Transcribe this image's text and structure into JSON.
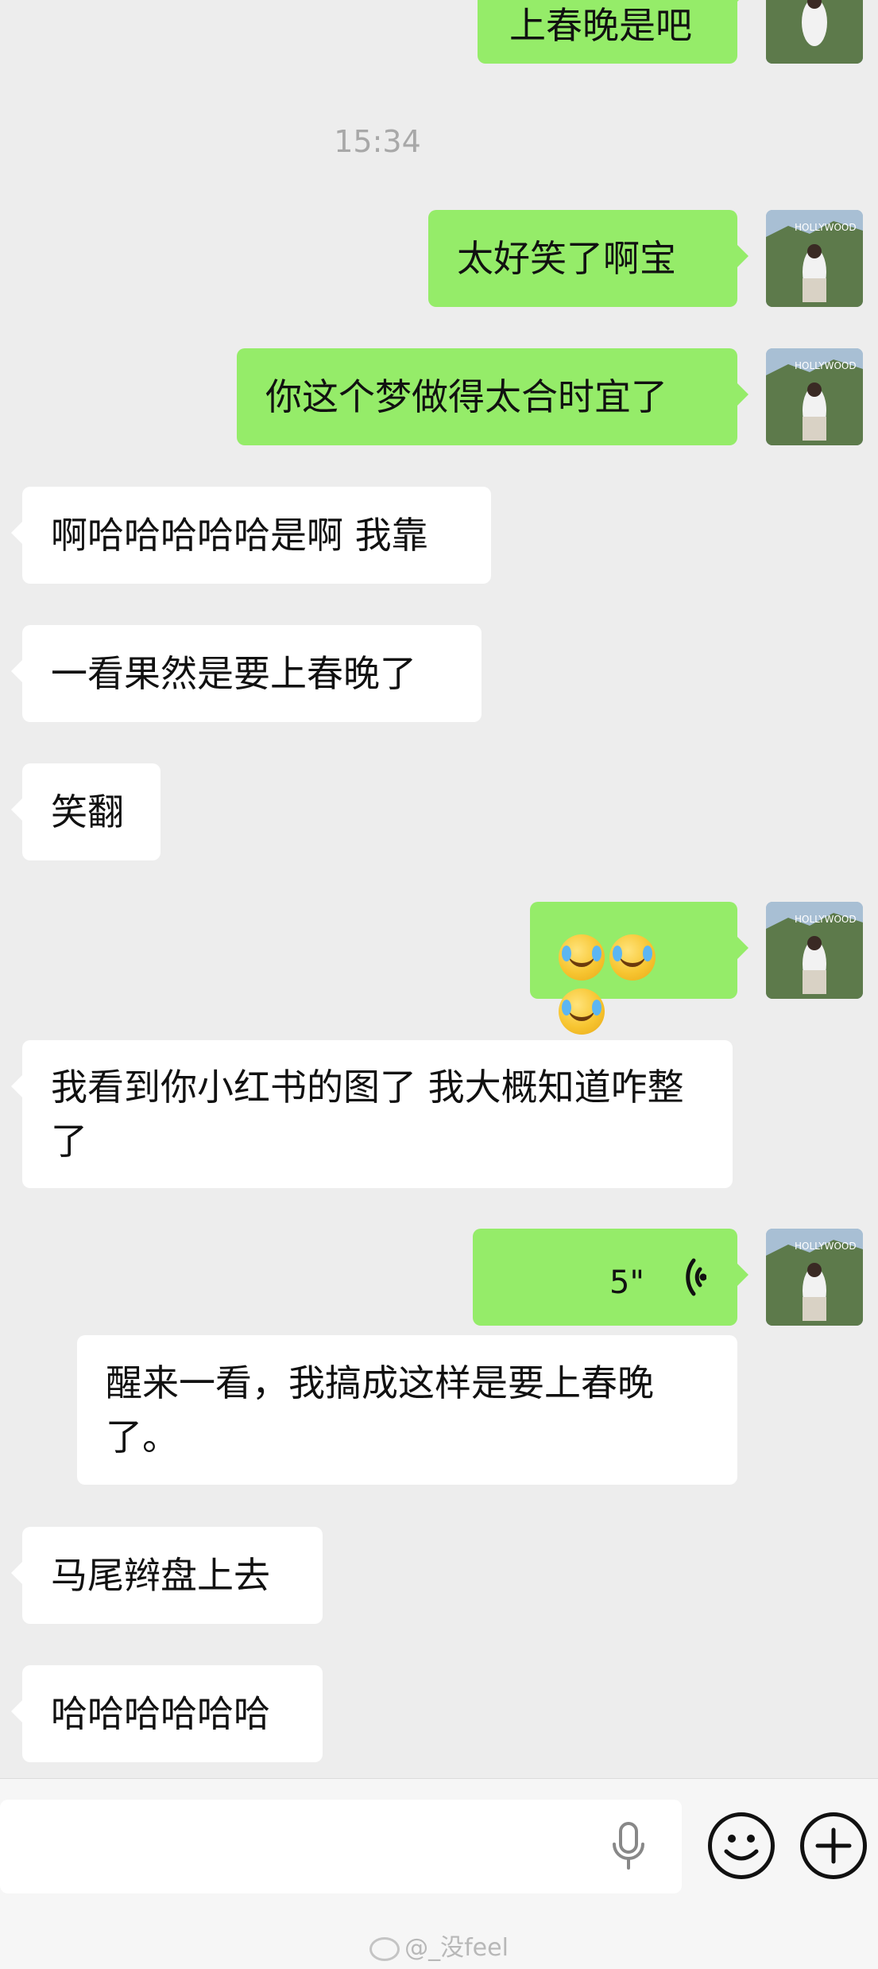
{
  "timestamp": "15:34",
  "messages": [
    {
      "side": "out",
      "text": "上春晚是吧"
    },
    {
      "side": "out",
      "text": "太好笑了啊宝"
    },
    {
      "side": "out",
      "text": "你这个梦做得太合时宜了"
    },
    {
      "side": "in",
      "text": "啊哈哈哈哈哈是啊 我靠"
    },
    {
      "side": "in",
      "text": "一看果然是要上春晚了"
    },
    {
      "side": "in",
      "text": "笑翻"
    },
    {
      "side": "out",
      "text": "",
      "emoji": [
        "face-with-tears-of-joy",
        "face-with-tears-of-joy",
        "face-with-tears-of-joy"
      ]
    },
    {
      "side": "in",
      "text": "我看到你小红书的图了 我大概知道咋整了"
    },
    {
      "side": "out",
      "text": "5\"",
      "type": "voice"
    },
    {
      "side": "transcript",
      "text": "醒来一看，我搞成这样是要上春晚了。"
    },
    {
      "side": "in",
      "text": "马尾辫盘上去"
    },
    {
      "side": "in",
      "text": "哈哈哈哈哈哈"
    }
  ],
  "input_bar": {
    "voice_icon": "microphone-icon",
    "emoji_icon": "smiley-icon",
    "plus_icon": "plus-icon"
  },
  "watermark": "@_没feel",
  "colors": {
    "outgoing_bubble": "#95ec69",
    "incoming_bubble": "#ffffff",
    "background": "#ededed"
  }
}
